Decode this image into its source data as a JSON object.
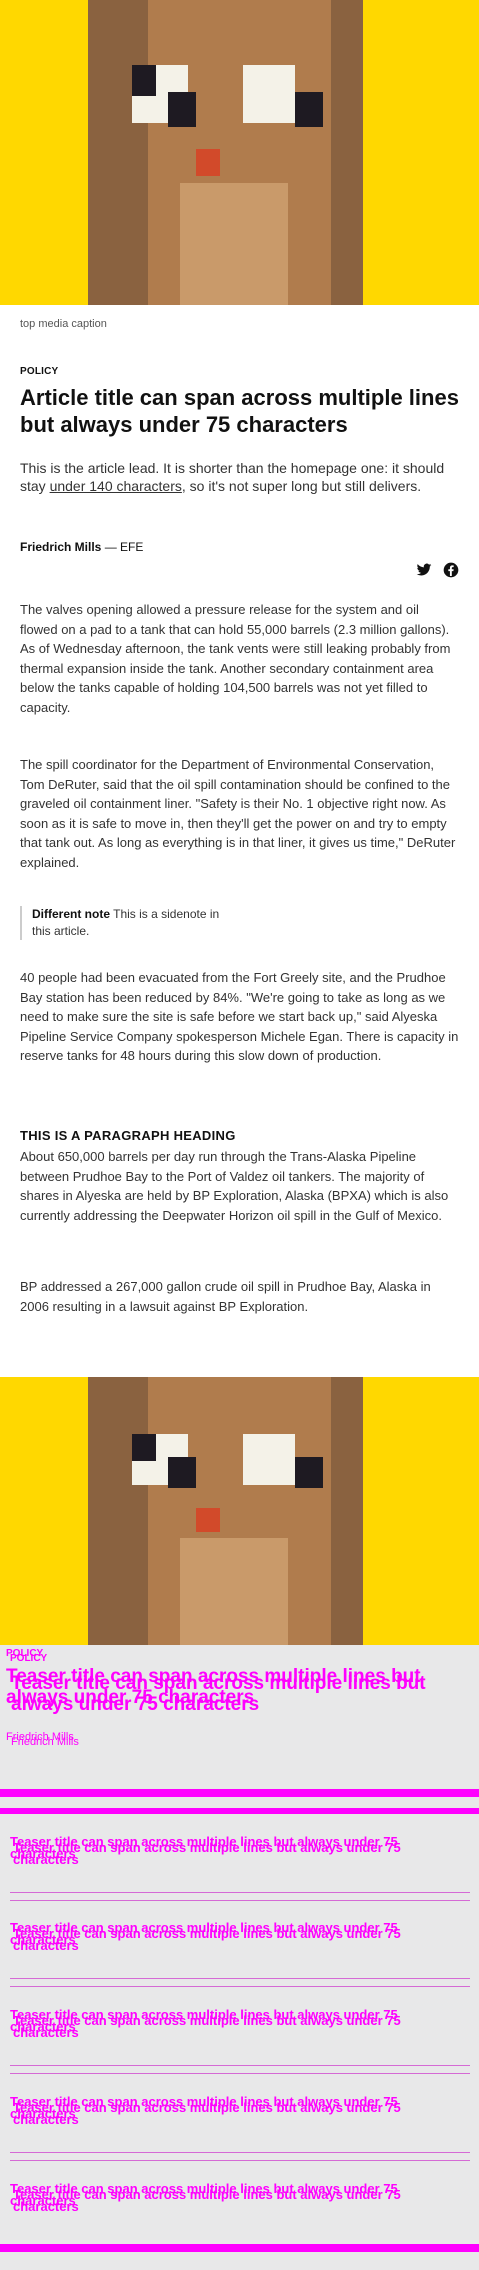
{
  "colors": {
    "yellow": "#ffd800",
    "brown_dark": "#8a6240",
    "brown_mid": "#b07c4d",
    "tan": "#c99a6a",
    "white": "#f4f2e8",
    "eye": "#1e1a22",
    "tongue": "#d24a2a",
    "magenta": "#ff00ff",
    "grey_bg": "#e8e8e9"
  },
  "top_media": {
    "caption": "top media caption"
  },
  "article": {
    "kicker": "POLICY",
    "title": "Article title can span across multiple lines but always under 75 characters",
    "lead_pre": "This is the article lead. It is shorter than the homepage one: it should stay ",
    "lead_link": "under 140 characters",
    "lead_post": ", so it's not super long but still delivers.",
    "author": "Friedrich Mills",
    "byline_sep": " — ",
    "agency": "EFE",
    "share_icons": [
      "twitter-icon",
      "facebook-icon"
    ],
    "paragraphs": [
      "The valves opening allowed a pressure release for the system and oil flowed on a pad to a tank that can hold 55,000 barrels (2.3 million gallons). As of Wednesday afternoon, the tank vents were still leaking probably from thermal expansion inside the tank. Another secondary containment area below the tanks capable of holding 104,500 barrels was not yet filled to capacity.",
      "The spill coordinator for the Department of Environmental Conservation, Tom DeRuter, said that the oil spill contamination should be confined to the graveled oil containment liner. \"Safety is their No. 1 objective right now. As soon as it is safe to move in, then they'll get the power on and try to empty that tank out. As long as everything is in that liner, it gives us time,\" DeRuter explained.",
      "40 people had been evacuated from the Fort Greely site, and the Prudhoe Bay station has been reduced by 84%. \"We're going to take as long as we need to make sure the site is safe before we start back up,\" said Alyeska Pipeline Service Company spokesperson Michele Egan. There is capacity in reserve tanks for 48 hours during this slow down of production.",
      "About 650,000 barrels per day run through the Trans-Alaska Pipeline between Prudhoe Bay to the Port of Valdez oil tankers. The majority of shares in Alyeska are held by BP Exploration, Alaska (BPXA) which is also currently addressing the Deepwater Horizon oil spill in the Gulf of Mexico.",
      "BP addressed a 267,000 gallon crude oil spill in Prudhoe Bay, Alaska in 2006 resulting in a lawsuit against BP Exploration."
    ],
    "sidenote_label": "Different note",
    "sidenote_text": " This is a sidenote in this article.",
    "paragraph_heading": "THIS IS A PARAGRAPH HEADING"
  },
  "teaser_hero": {
    "kicker": "POLICY",
    "title": "Teaser title can span across multiple lines but always under 75 characters",
    "author": "Friedrich Mills"
  },
  "teasers": [
    {
      "title": "Teaser title can span across multiple lines but always under 75 characters"
    },
    {
      "title": "Teaser title can span across multiple lines but always under 75 characters"
    },
    {
      "title": "Teaser title can span across multiple lines but always under 75 characters"
    },
    {
      "title": "Teaser title can span across multiple lines but always under 75 characters"
    },
    {
      "title": "Teaser title can span across multiple lines but always under 75 characters"
    }
  ]
}
